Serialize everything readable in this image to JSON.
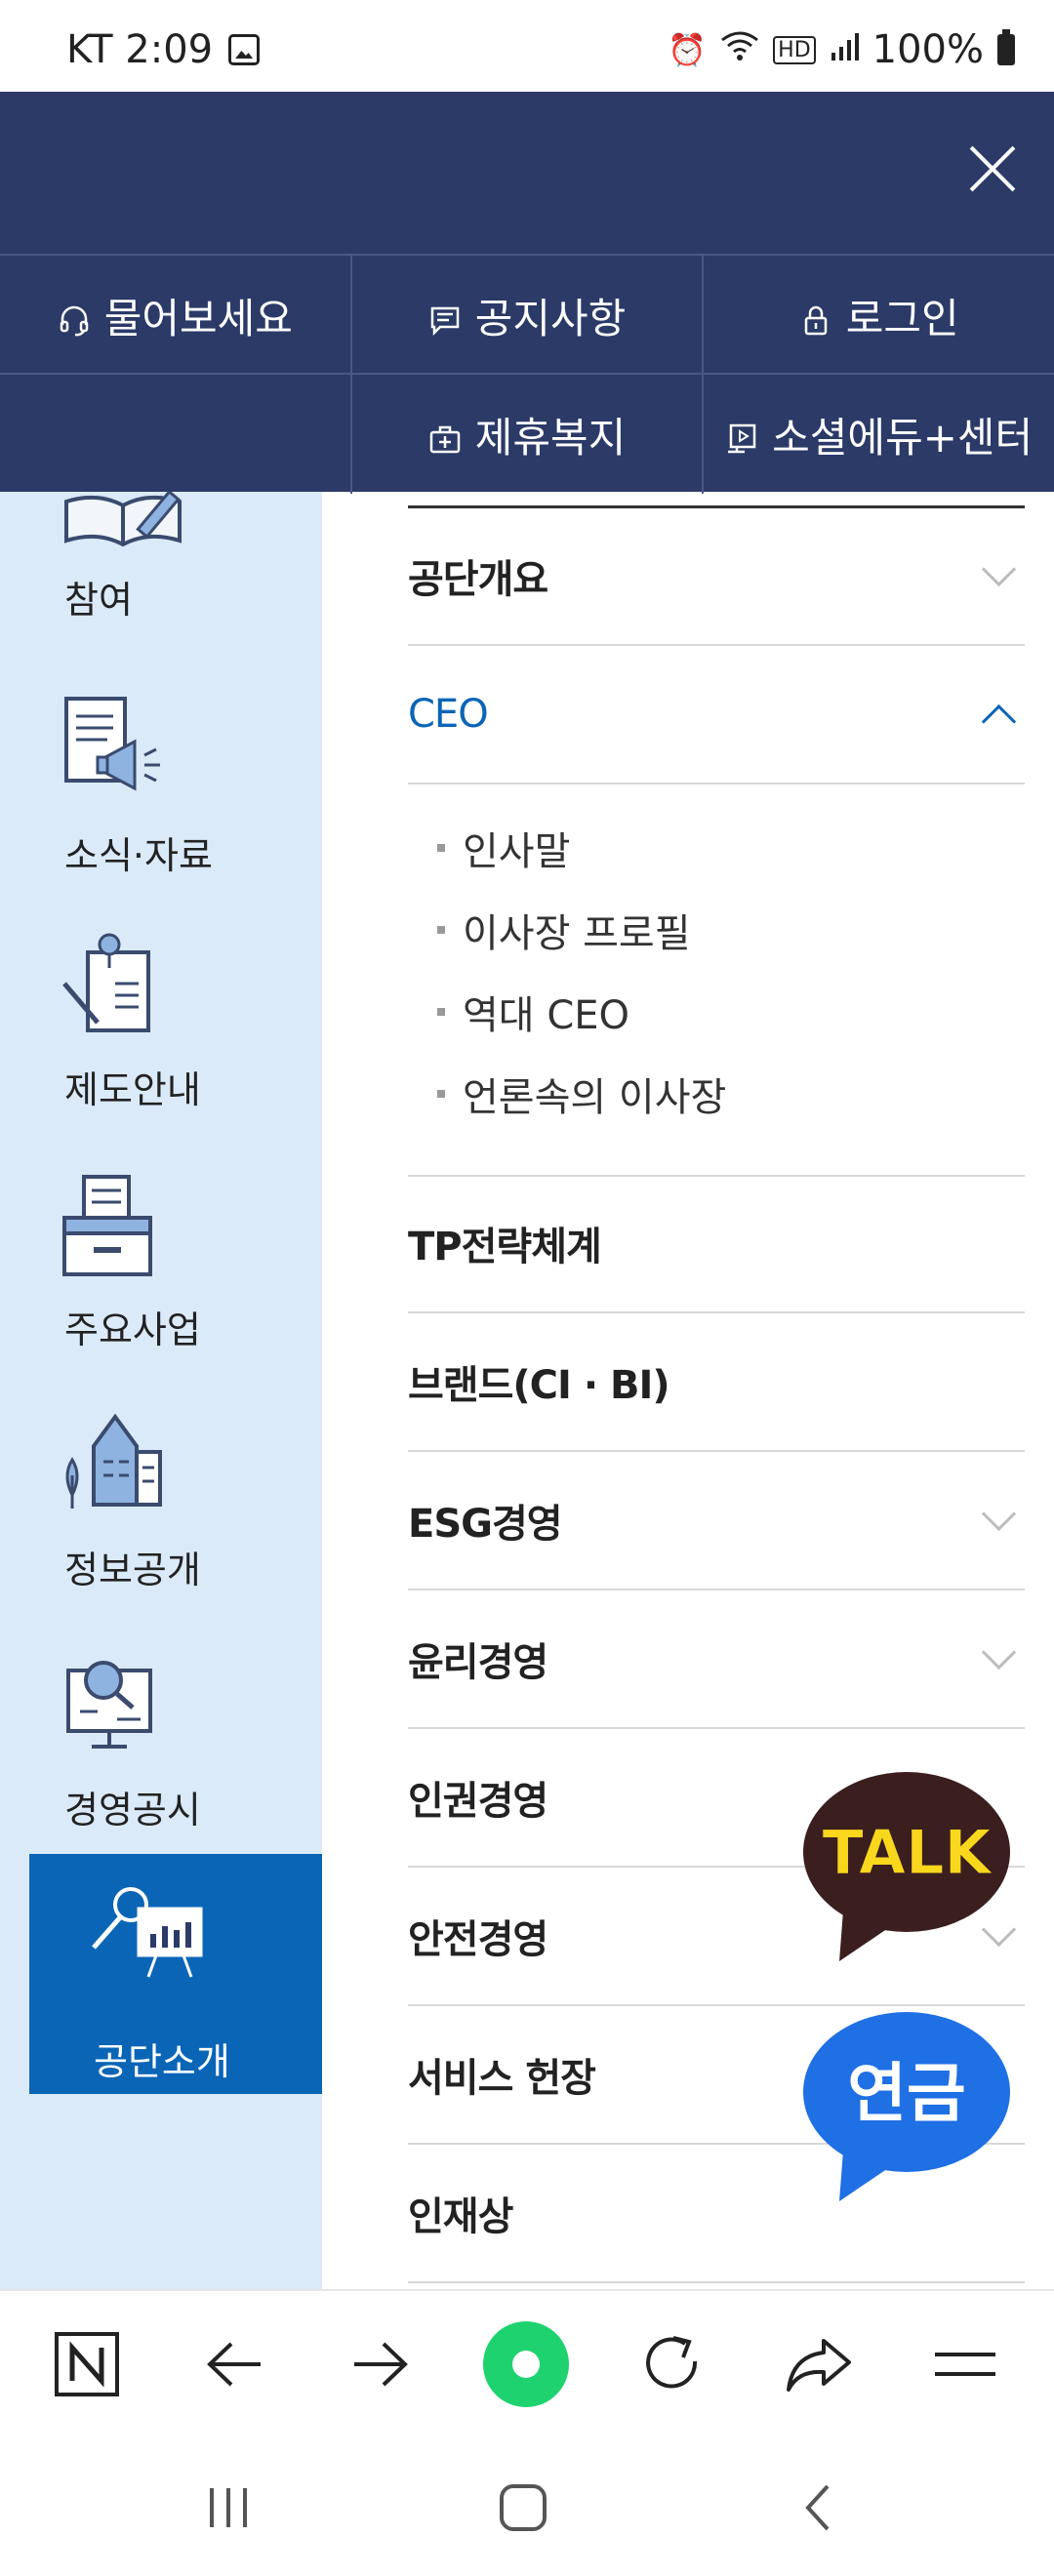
{
  "status_bar": {
    "carrier_time": "KT 2:09",
    "battery": "100%"
  },
  "header": {
    "utility_links": [
      {
        "label": "물어보세요",
        "icon": "headset-icon"
      },
      {
        "label": "공지사항",
        "icon": "notice-icon"
      },
      {
        "label": "로그인",
        "icon": "lock-icon"
      },
      {
        "label": "제휴복지",
        "icon": "welfare-icon"
      },
      {
        "label": "소셜에듀+센터",
        "icon": "video-board-icon"
      }
    ]
  },
  "sidebar": {
    "items": [
      {
        "label": "참여",
        "icon": "book-pencil-icon"
      },
      {
        "label": "소식·자료",
        "icon": "megaphone-document-icon"
      },
      {
        "label": "제도안내",
        "icon": "pin-document-icon"
      },
      {
        "label": "주요사업",
        "icon": "inbox-tray-icon"
      },
      {
        "label": "정보공개",
        "icon": "building-icon"
      },
      {
        "label": "경영공시",
        "icon": "magnifier-monitor-icon"
      },
      {
        "label": "공단소개",
        "icon": "presentation-icon",
        "active": true
      }
    ]
  },
  "menu": {
    "items": [
      {
        "label": "공단개요",
        "has_children": true,
        "expanded": false
      },
      {
        "label": "CEO",
        "has_children": true,
        "expanded": true
      },
      {
        "label": "TP전략체계",
        "has_children": false
      },
      {
        "label": "브랜드(CI · BI)",
        "has_children": false
      },
      {
        "label": "ESG경영",
        "has_children": true,
        "expanded": false
      },
      {
        "label": "윤리경영",
        "has_children": true,
        "expanded": false
      },
      {
        "label": "인권경영",
        "has_children": false
      },
      {
        "label": "안전경영",
        "has_children": true,
        "expanded": false
      },
      {
        "label": "서비스 헌장",
        "has_children": false
      },
      {
        "label": "인재상",
        "has_children": false
      }
    ],
    "ceo_submenu": [
      "인사말",
      "이사장 프로필",
      "역대 CEO",
      "언론속의 이사장"
    ]
  },
  "floating": {
    "talk_label": "TALK",
    "pension_label": "연금"
  },
  "colors": {
    "header_bg": "#2b3a67",
    "sidebar_bg": "#dbeaf8",
    "active_blue": "#0a65b7",
    "talk_bg": "#3b1e1e",
    "talk_text": "#f9d71c",
    "pension_bg": "#1f6fe5"
  }
}
